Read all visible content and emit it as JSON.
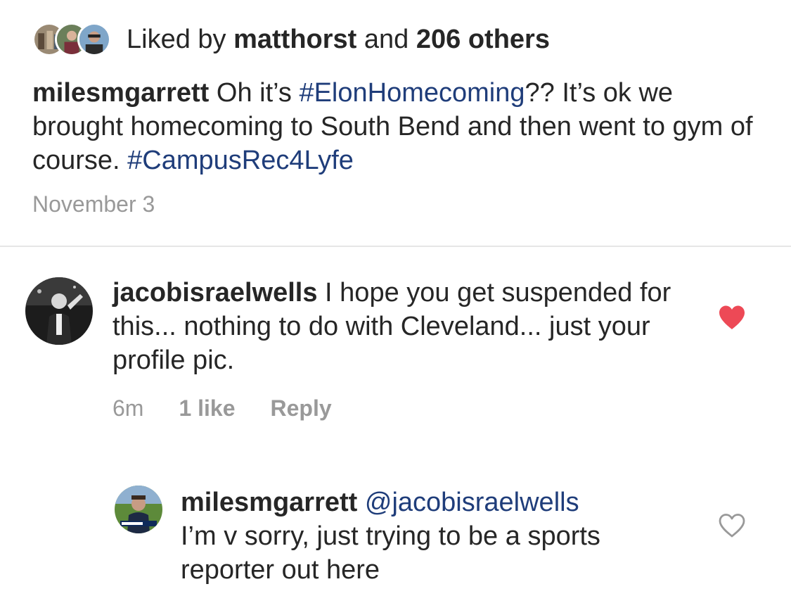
{
  "likes": {
    "prefix": "Liked by",
    "user": "matthorst",
    "connector": "and",
    "others": "206 others"
  },
  "caption": {
    "username": "milesmgarrett",
    "text_1": " Oh it’s ",
    "hashtag_1": "#ElonHomecoming",
    "text_2": "?? It’s ok we brought homecoming to South Bend and then went to gym of course. ",
    "hashtag_2": "#CampusRec4Lyfe"
  },
  "post_date": "November 3",
  "comments": [
    {
      "username": "jacobisraelwells",
      "text": " I hope you get suspended for this... nothing to do with Cleveland... just your profile pic.",
      "time": "6m",
      "likes": "1 like",
      "reply_label": "Reply",
      "liked": true
    },
    {
      "username": "milesmgarrett",
      "mention": "@jacobisraelwells",
      "text": "I’m v sorry, just trying to be a sports reporter out here",
      "liked": false
    }
  ],
  "colors": {
    "hashtag": "#1f3d7a",
    "heart_liked": "#ed4956",
    "muted_text": "#999999",
    "primary_text": "#262626"
  },
  "icons": {
    "liked_heart": "heart-filled-icon",
    "unliked_heart": "heart-outline-icon"
  }
}
